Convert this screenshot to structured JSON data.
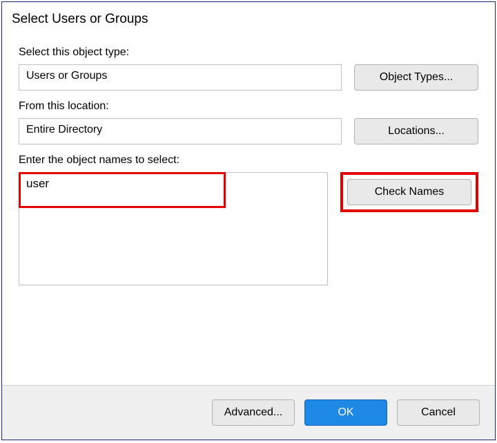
{
  "dialog": {
    "title": "Select Users or Groups",
    "objectType": {
      "label": "Select this object type:",
      "value": "Users or Groups",
      "button": "Object Types..."
    },
    "location": {
      "label": "From this location:",
      "value": "Entire Directory",
      "button": "Locations..."
    },
    "objectNames": {
      "label": "Enter the object names to select:",
      "value": "user",
      "button": "Check Names"
    },
    "footer": {
      "advanced": "Advanced...",
      "ok": "OK",
      "cancel": "Cancel"
    }
  }
}
